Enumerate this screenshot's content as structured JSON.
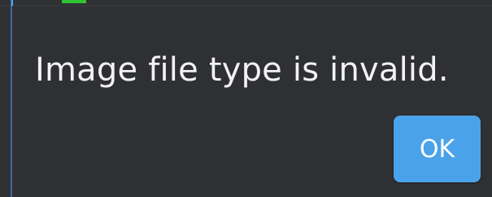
{
  "dialog": {
    "message": "Image file type is invalid.",
    "ok_label": "OK"
  },
  "colors": {
    "background": "#2f3033",
    "accent": "#4aa3ea",
    "text": "#f2f2f2",
    "green_indicator": "#30c230"
  },
  "icons": {
    "background_indicator": "green-status-indicator"
  }
}
